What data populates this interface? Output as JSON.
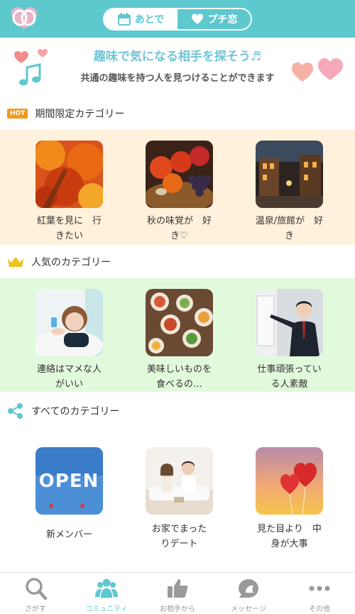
{
  "header": {
    "segments": [
      {
        "label": "あとで",
        "icon": "calendar-icon",
        "active": false
      },
      {
        "label": "プチ恋",
        "icon": "heart-icon",
        "active": true
      }
    ]
  },
  "banner": {
    "title": "趣味で気になる相手を探そう♬",
    "subtitle": "共通の趣味を持つ人を見つけることができます"
  },
  "sections": [
    {
      "title": "期間限定カテゴリー",
      "badge": "HOT",
      "bg": "#fff1dc",
      "items": [
        {
          "caption_l1": "紅葉を見に　行",
          "caption_l2": "きたい"
        },
        {
          "caption_l1": "秋の味覚が　好",
          "caption_l2": "き♡"
        },
        {
          "caption_l1": "温泉/旅館が　好",
          "caption_l2": "き"
        }
      ]
    },
    {
      "title": "人気のカテゴリー",
      "icon": "crown-icon",
      "bg": "#e2fadc",
      "items": [
        {
          "caption_l1": "連絡はマメな人",
          "caption_l2": "がいい"
        },
        {
          "caption_l1": "美味しいものを",
          "caption_l2": "食べるの…"
        },
        {
          "caption_l1": "仕事頑張ってい",
          "caption_l2": "る人素敵"
        }
      ]
    },
    {
      "title": "すべてのカテゴリー",
      "icon": "share-icon",
      "bg": "#ffffff",
      "items": [
        {
          "caption_l1": "新メンバー",
          "caption_l2": "",
          "image_text": "OPEN"
        },
        {
          "caption_l1": "お家でまった",
          "caption_l2": "りデート"
        },
        {
          "caption_l1": "見た目より　中",
          "caption_l2": "身が大事"
        }
      ]
    }
  ],
  "tabbar": [
    {
      "label": "さがす",
      "icon": "search-icon",
      "active": false
    },
    {
      "label": "コミュニティ",
      "icon": "community-icon",
      "active": true
    },
    {
      "label": "お相手から",
      "icon": "thumbs-up-icon",
      "active": false
    },
    {
      "label": "メッセージ",
      "icon": "message-icon",
      "active": false
    },
    {
      "label": "その他",
      "icon": "more-icon",
      "active": false
    }
  ],
  "colors": {
    "accent": "#5ec8cf",
    "hot": "#f39a1a",
    "heart": "#f5a3a3"
  }
}
